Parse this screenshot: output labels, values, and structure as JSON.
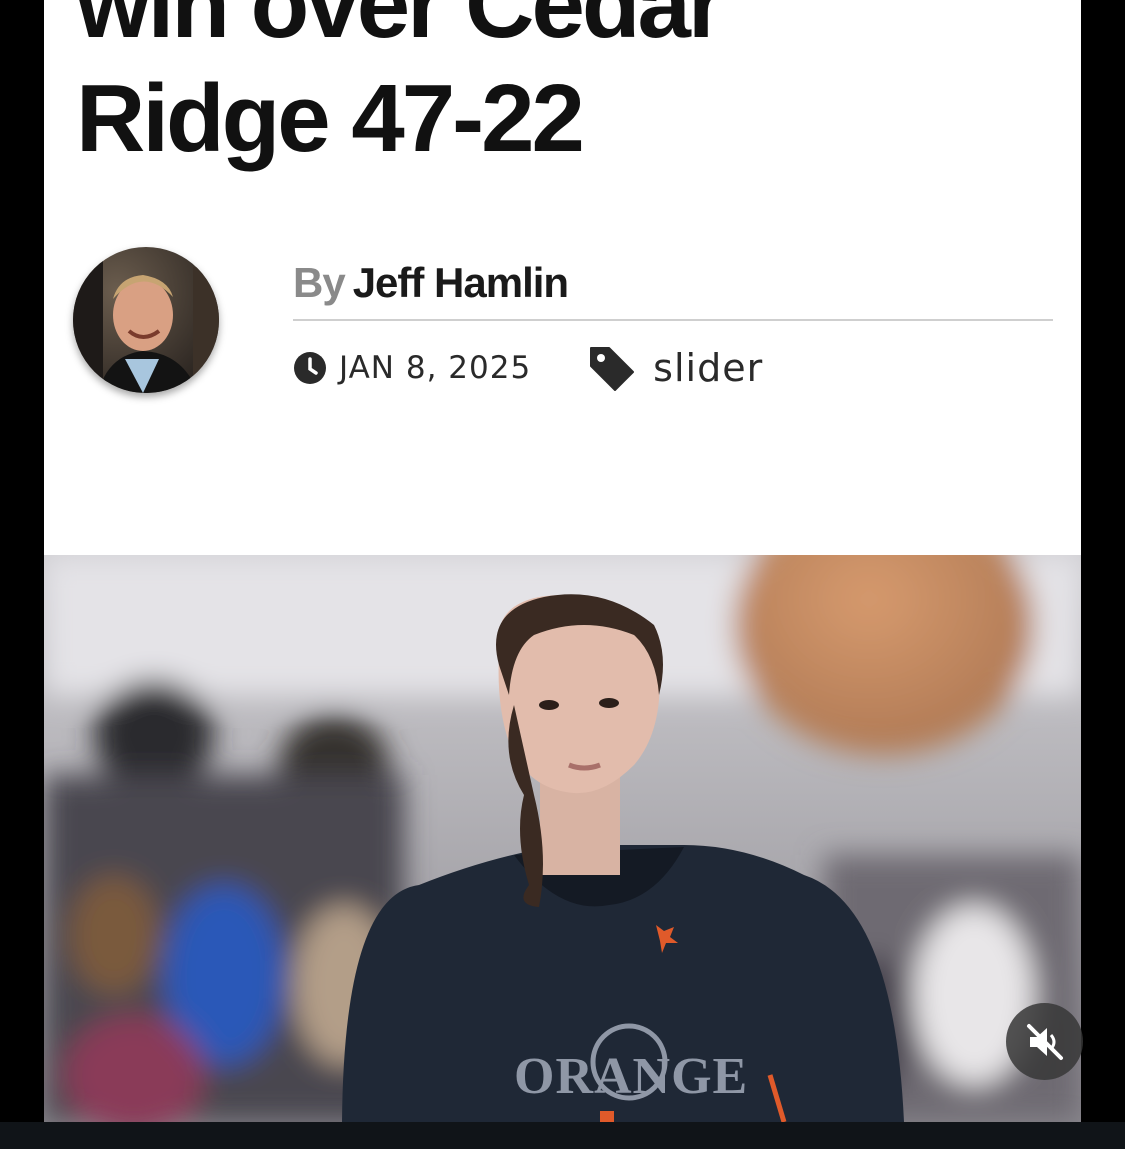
{
  "article": {
    "headline_line1": "win over Cedar",
    "headline_line2": "Ridge 47-22",
    "byline_prefix": "By",
    "author": "Jeff Hamlin",
    "date": "JAN 8, 2025",
    "category": "slider"
  },
  "photo": {
    "jersey_text": "ORANGE"
  },
  "video": {
    "mute_icon": "speaker-muted-icon"
  },
  "colors": {
    "jersey": "#1f2836",
    "jersey_accent": "#e05a2a",
    "background": "#000000"
  }
}
